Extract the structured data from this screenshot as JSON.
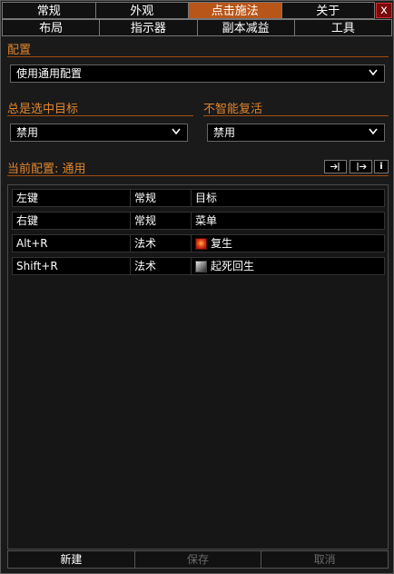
{
  "tabs_row1": [
    "常规",
    "外观",
    "点击施法",
    "关于"
  ],
  "tabs_row2": [
    "布局",
    "指示器",
    "副本减益",
    "工具"
  ],
  "active_tab": "点击施法",
  "close_label": "x",
  "config_section": {
    "title": "配置",
    "selected": "使用通用配置"
  },
  "always_target": {
    "title": "总是选中目标",
    "selected": "禁用"
  },
  "no_smart_res": {
    "title": "不智能复活",
    "selected": "禁用"
  },
  "current_config": {
    "title": "当前配置: 通用"
  },
  "bindings": [
    {
      "key": "左键",
      "type": "常规",
      "action": "目标",
      "icon": ""
    },
    {
      "key": "右键",
      "type": "常规",
      "action": "菜单",
      "icon": ""
    },
    {
      "key": "Alt+R",
      "type": "法术",
      "action": "复生",
      "icon": "rebirth-icon"
    },
    {
      "key": "Shift+R",
      "type": "法术",
      "action": "起死回生",
      "icon": "revive-icon"
    }
  ],
  "bottom": {
    "new": "新建",
    "save": "保存",
    "cancel": "取消"
  },
  "colors": {
    "accent": "#e0852d",
    "active_tab": "#b8561a",
    "close": "#7a0b0b"
  }
}
